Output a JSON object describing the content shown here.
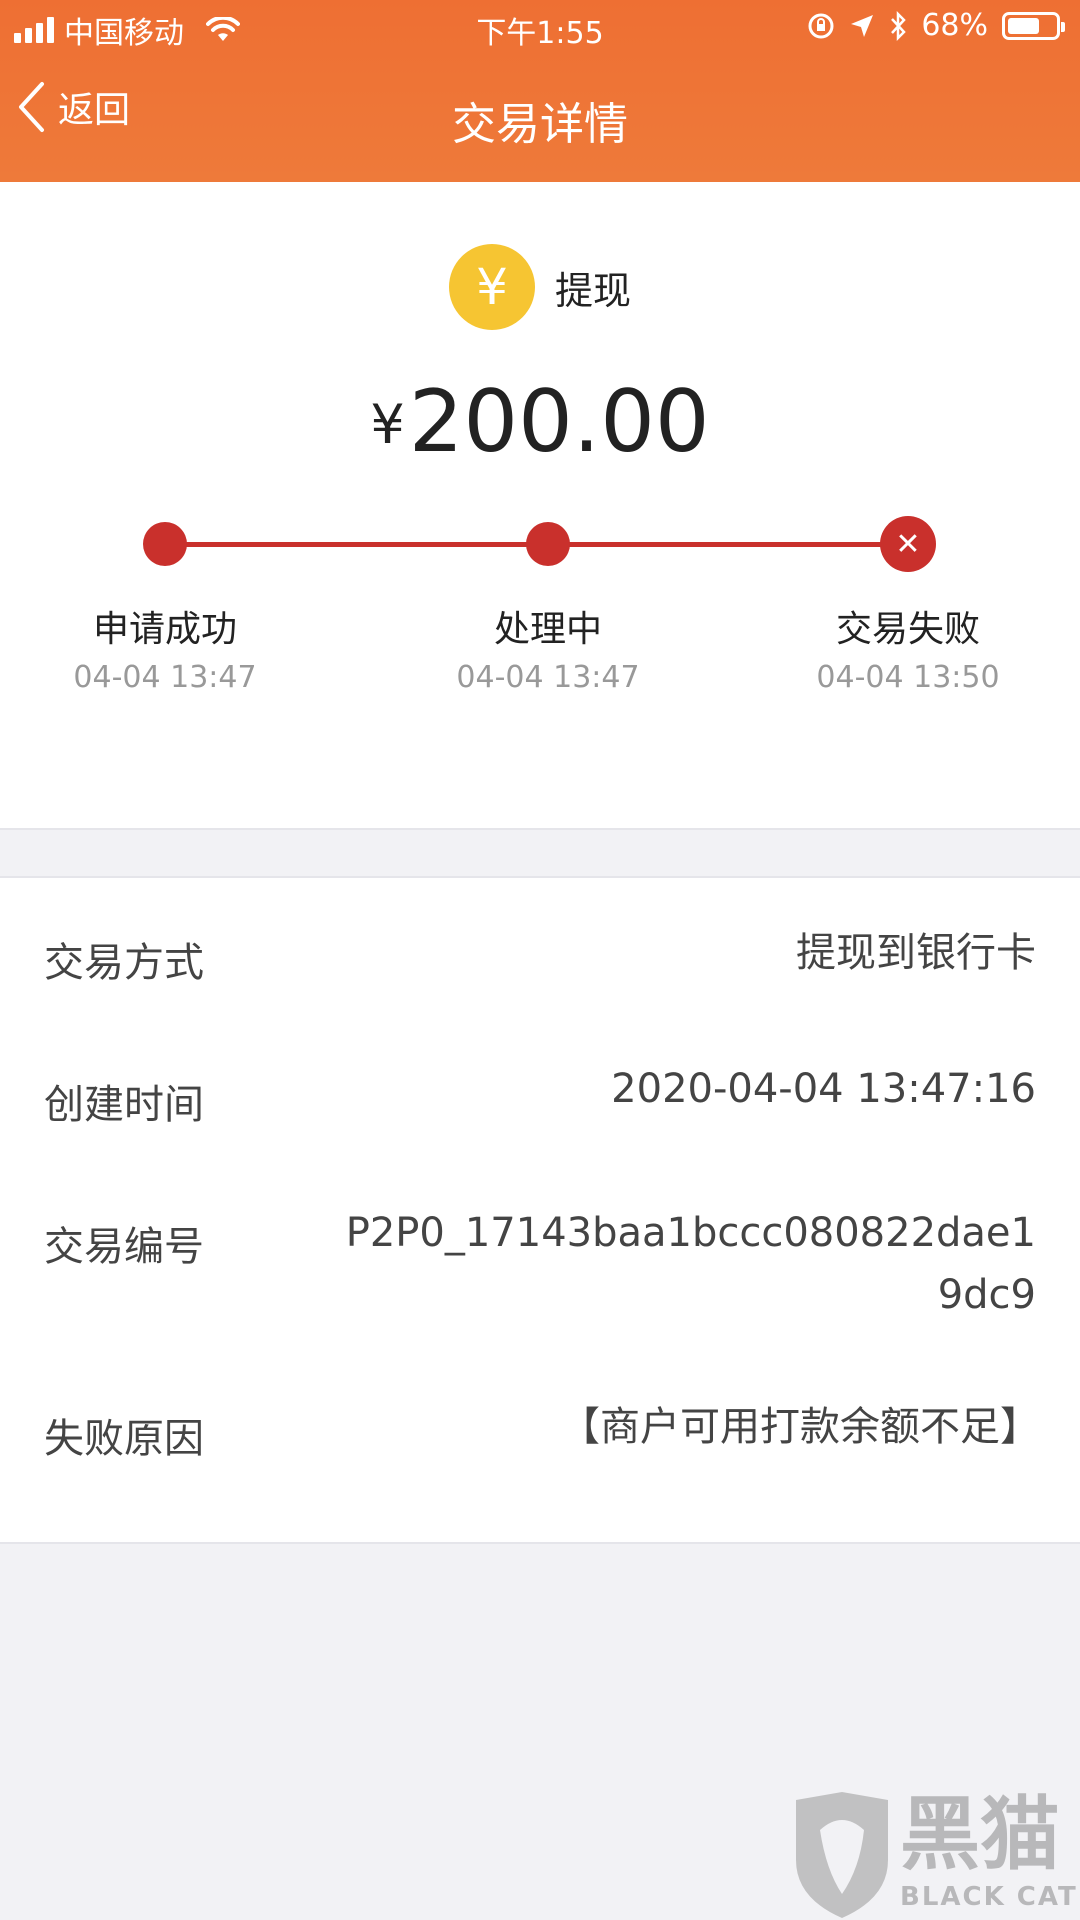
{
  "status_bar": {
    "carrier": "中国移动",
    "time": "下午1:55",
    "battery": "68%",
    "battery_level": 0.68
  },
  "nav": {
    "back_label": "返回",
    "title": "交易详情"
  },
  "transaction": {
    "icon_symbol": "¥",
    "type": "提现",
    "currency": "¥",
    "amount": "200.00"
  },
  "steps": [
    {
      "label": "申请成功",
      "time": "04-04 13:47",
      "status": "done"
    },
    {
      "label": "处理中",
      "time": "04-04 13:47",
      "status": "done"
    },
    {
      "label": "交易失败",
      "time": "04-04 13:50",
      "status": "failed"
    }
  ],
  "details": [
    {
      "key": "交易方式",
      "value": "提现到银行卡"
    },
    {
      "key": "创建时间",
      "value": "2020-04-04 13:47:16"
    },
    {
      "key": "交易编号",
      "value": "P2P0_17143baa1bccc080822dae19dc9"
    },
    {
      "key": "失败原因",
      "value": "【商户可用打款余额不足】"
    }
  ],
  "watermark": {
    "text_cn": "黑猫",
    "text_en": "BLACK CAT"
  },
  "colors": {
    "header": "#ee7336",
    "progress": "#c9302c",
    "yen_badge": "#f6c532"
  }
}
